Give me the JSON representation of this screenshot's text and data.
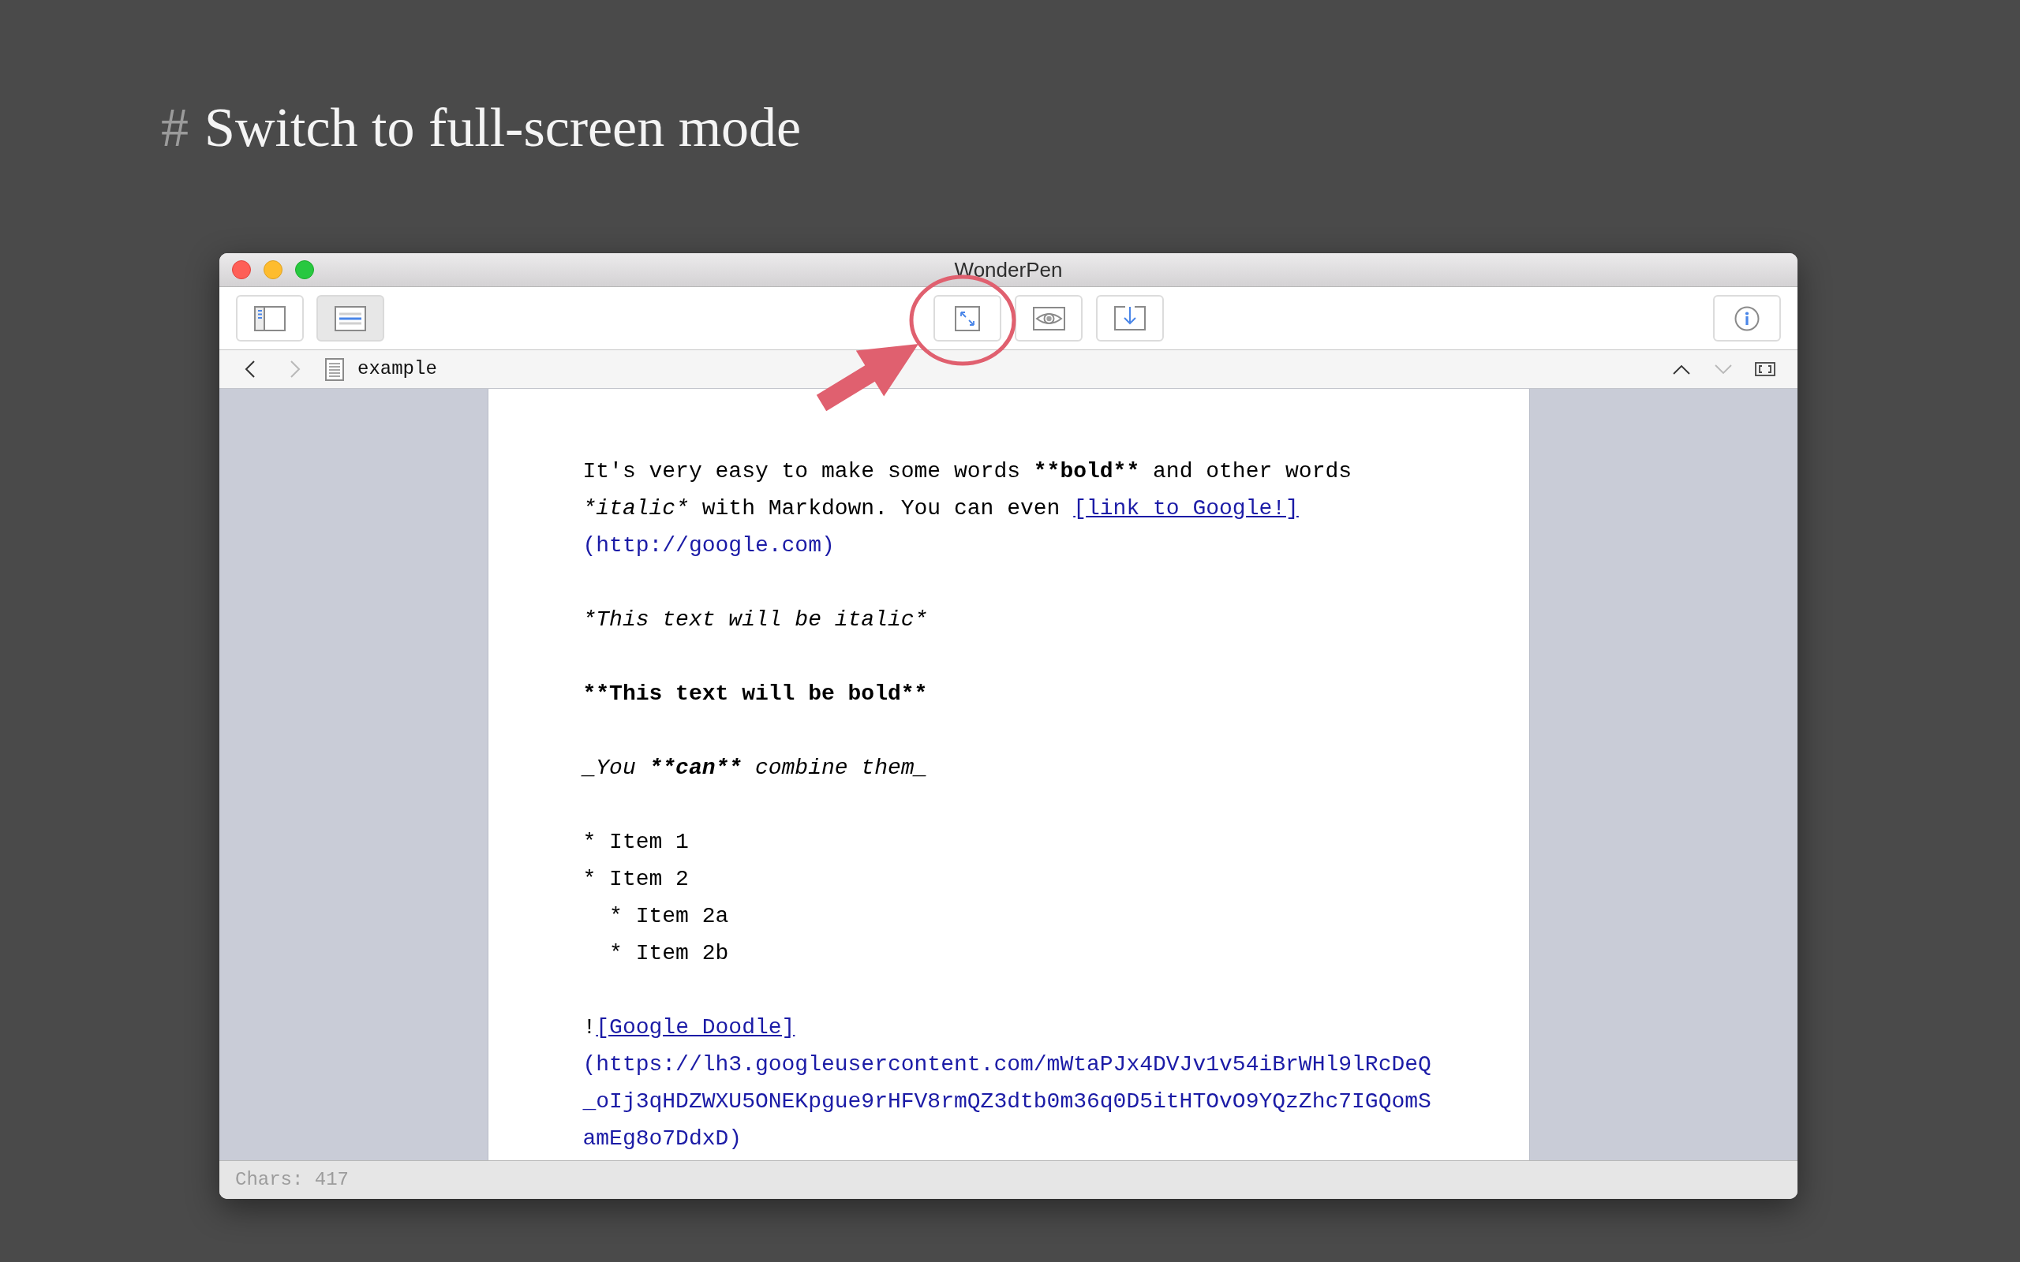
{
  "heading": {
    "marker": "#",
    "text": "Switch to full-screen mode"
  },
  "window": {
    "title": "WonderPen"
  },
  "toolbar": {
    "view_buttons": [
      {
        "kind": "sidebar",
        "selected": false
      },
      {
        "kind": "editor",
        "selected": true
      }
    ],
    "action_buttons": [
      {
        "kind": "fullscreen",
        "highlighted": true
      },
      {
        "kind": "preview",
        "highlighted": false
      },
      {
        "kind": "export",
        "highlighted": false
      }
    ]
  },
  "path_bar": {
    "back_disabled": false,
    "forward_disabled": true,
    "document": "example",
    "up_disabled": false,
    "down_disabled": true
  },
  "editor": {
    "blocks": [
      {
        "kind": "paragraph",
        "segments": [
          {
            "kind": "plain",
            "text": "It's very easy to make some words "
          },
          {
            "kind": "bold",
            "text": "**bold**"
          },
          {
            "kind": "plain",
            "text": " and other words "
          },
          {
            "kind": "italic",
            "text": "*italic*"
          },
          {
            "kind": "plain",
            "text": " with Markdown. You can even "
          },
          {
            "kind": "link",
            "text": "[link to Google!]"
          },
          {
            "kind": "url",
            "text": "(http://google.com)"
          }
        ]
      },
      {
        "kind": "paragraph",
        "segments": [
          {
            "kind": "italic",
            "text": "*This text will be italic*"
          }
        ]
      },
      {
        "kind": "paragraph",
        "segments": [
          {
            "kind": "bold",
            "text": "**This text will be bold**"
          }
        ]
      },
      {
        "kind": "paragraph",
        "segments": [
          {
            "kind": "italic",
            "text": "_You "
          },
          {
            "kind": "bold_italic",
            "text": "**can**"
          },
          {
            "kind": "italic",
            "text": " combine them_"
          }
        ]
      },
      {
        "kind": "list",
        "items": [
          {
            "text": "* Item 1"
          },
          {
            "text": "* Item 2",
            "children": [
              {
                "text": "* Item 2a"
              },
              {
                "text": "* Item 2b"
              }
            ]
          }
        ]
      },
      {
        "kind": "paragraph",
        "segments": [
          {
            "kind": "plain",
            "text": "!"
          },
          {
            "kind": "link",
            "text": "[Google Doodle]"
          },
          {
            "kind": "url",
            "text": "(https://lh3.googleusercontent.com/mWtaPJx4DVJv1v54iBrWHl9lRcDeQ_oIj3qHDZWXU5ONEKpgue9rHFV8rmQZ3dtb0m36q0D5itHTOvO9YQzZhc7IGQomSamEg8o7DdxD)"
          }
        ]
      }
    ]
  },
  "status_bar": {
    "text": "Chars: 417"
  }
}
